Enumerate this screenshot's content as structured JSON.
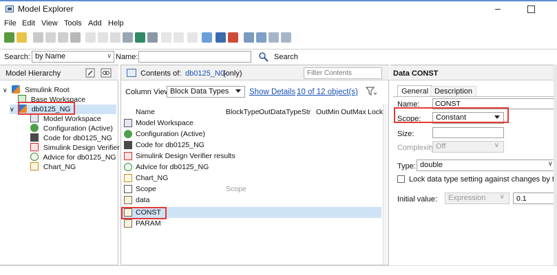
{
  "window": {
    "title": "Model Explorer",
    "minimize_glyph": "–"
  },
  "menu": [
    "File",
    "Edit",
    "View",
    "Tools",
    "Add",
    "Help"
  ],
  "search": {
    "label": "Search:",
    "mode": "by Name",
    "name_label": "Name:",
    "name_value": "",
    "button": "Search"
  },
  "hierarchy": {
    "title": "Model Hierarchy",
    "items": [
      {
        "label": "Simulink Root",
        "icon": "simulink-root-icon"
      },
      {
        "label": "Base Workspace",
        "icon": "workspace-icon"
      },
      {
        "label": "db0125_NG",
        "icon": "model-icon"
      },
      {
        "label": "Model Workspace",
        "icon": "model-workspace-icon"
      },
      {
        "label": "Configuration (Active)",
        "icon": "configuration-icon"
      },
      {
        "label": "Code for db0125_NG",
        "icon": "code-icon"
      },
      {
        "label": "Simulink Design Verifier",
        "icon": "design-verifier-icon"
      },
      {
        "label": "Advice for db0125_NG",
        "icon": "advisor-icon"
      },
      {
        "label": "Chart_NG",
        "icon": "chart-icon"
      }
    ]
  },
  "contents": {
    "prefix": "Contents of:",
    "model_link": "db0125_NG",
    "suffix": "(only)",
    "filter_placeholder": "Filter Contents",
    "column_view_label": "Column View:",
    "column_view_value": "Block Data Types",
    "show_details": "Show Details",
    "object_count": "10 of 12 object(s)",
    "columns": [
      "Name",
      "BlockType",
      "OutDataTypeStr",
      "OutMin",
      "OutMax",
      "LockS"
    ],
    "rows": [
      {
        "name": "Model Workspace",
        "blocktype": "",
        "icon": "model-workspace-icon"
      },
      {
        "name": "Configuration (Active)",
        "blocktype": "",
        "icon": "configuration-icon"
      },
      {
        "name": "Code for db0125_NG",
        "blocktype": "",
        "icon": "code-icon"
      },
      {
        "name": "Simulink Design Verifier results",
        "blocktype": "",
        "icon": "design-verifier-icon"
      },
      {
        "name": "Advice for db0125_NG",
        "blocktype": "",
        "icon": "advisor-icon"
      },
      {
        "name": "Chart_NG",
        "blocktype": "",
        "icon": "chart-icon"
      },
      {
        "name": "Scope",
        "blocktype": "Scope",
        "icon": "scope-icon"
      },
      {
        "name": "data",
        "blocktype": "",
        "icon": "data-icon"
      },
      {
        "name": "CONST",
        "blocktype": "",
        "icon": "data-icon"
      },
      {
        "name": "PARAM",
        "blocktype": "",
        "icon": "data-icon"
      }
    ]
  },
  "data_panel": {
    "title": "Data CONST",
    "tabs": [
      "General",
      "Description"
    ],
    "name_label": "Name:",
    "name_value": "CONST",
    "scope_label": "Scope:",
    "scope_value": "Constant",
    "size_label": "Size:",
    "size_value": "",
    "complexity_label": "Complexity:",
    "complexity_value": "Off",
    "type_label": "Type:",
    "type_value": "double",
    "lock_label": "Lock data type setting against changes by the",
    "initial_label": "Initial value:",
    "initial_mode": "Expression",
    "initial_value": "0.1"
  },
  "colors": {
    "highlight": "#e53935",
    "selection": "#cfe3f7",
    "link": "#1a4fb4"
  }
}
